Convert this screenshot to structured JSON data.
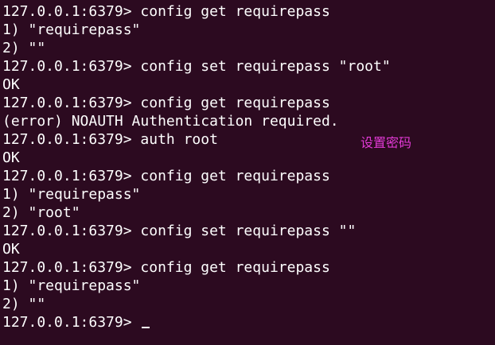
{
  "terminal": {
    "lines": [
      "127.0.0.1:6379> config get requirepass",
      "1) \"requirepass\"",
      "2) \"\"",
      "127.0.0.1:6379> config set requirepass \"root\"",
      "OK",
      "127.0.0.1:6379> config get requirepass",
      "(error) NOAUTH Authentication required.",
      "127.0.0.1:6379> auth root",
      "OK",
      "127.0.0.1:6379> config get requirepass",
      "1) \"requirepass\"",
      "2) \"root\"",
      "127.0.0.1:6379> config set requirepass \"\"",
      "OK",
      "127.0.0.1:6379> config get requirepass",
      "1) \"requirepass\"",
      "2) \"\""
    ],
    "prompt": "127.0.0.1:6379> ",
    "top_mark": "'"
  },
  "annotation": {
    "text": "设置密码"
  },
  "colors": {
    "background": "#2c0a20",
    "text": "#ffffff",
    "annotation": "#e23ad6"
  }
}
